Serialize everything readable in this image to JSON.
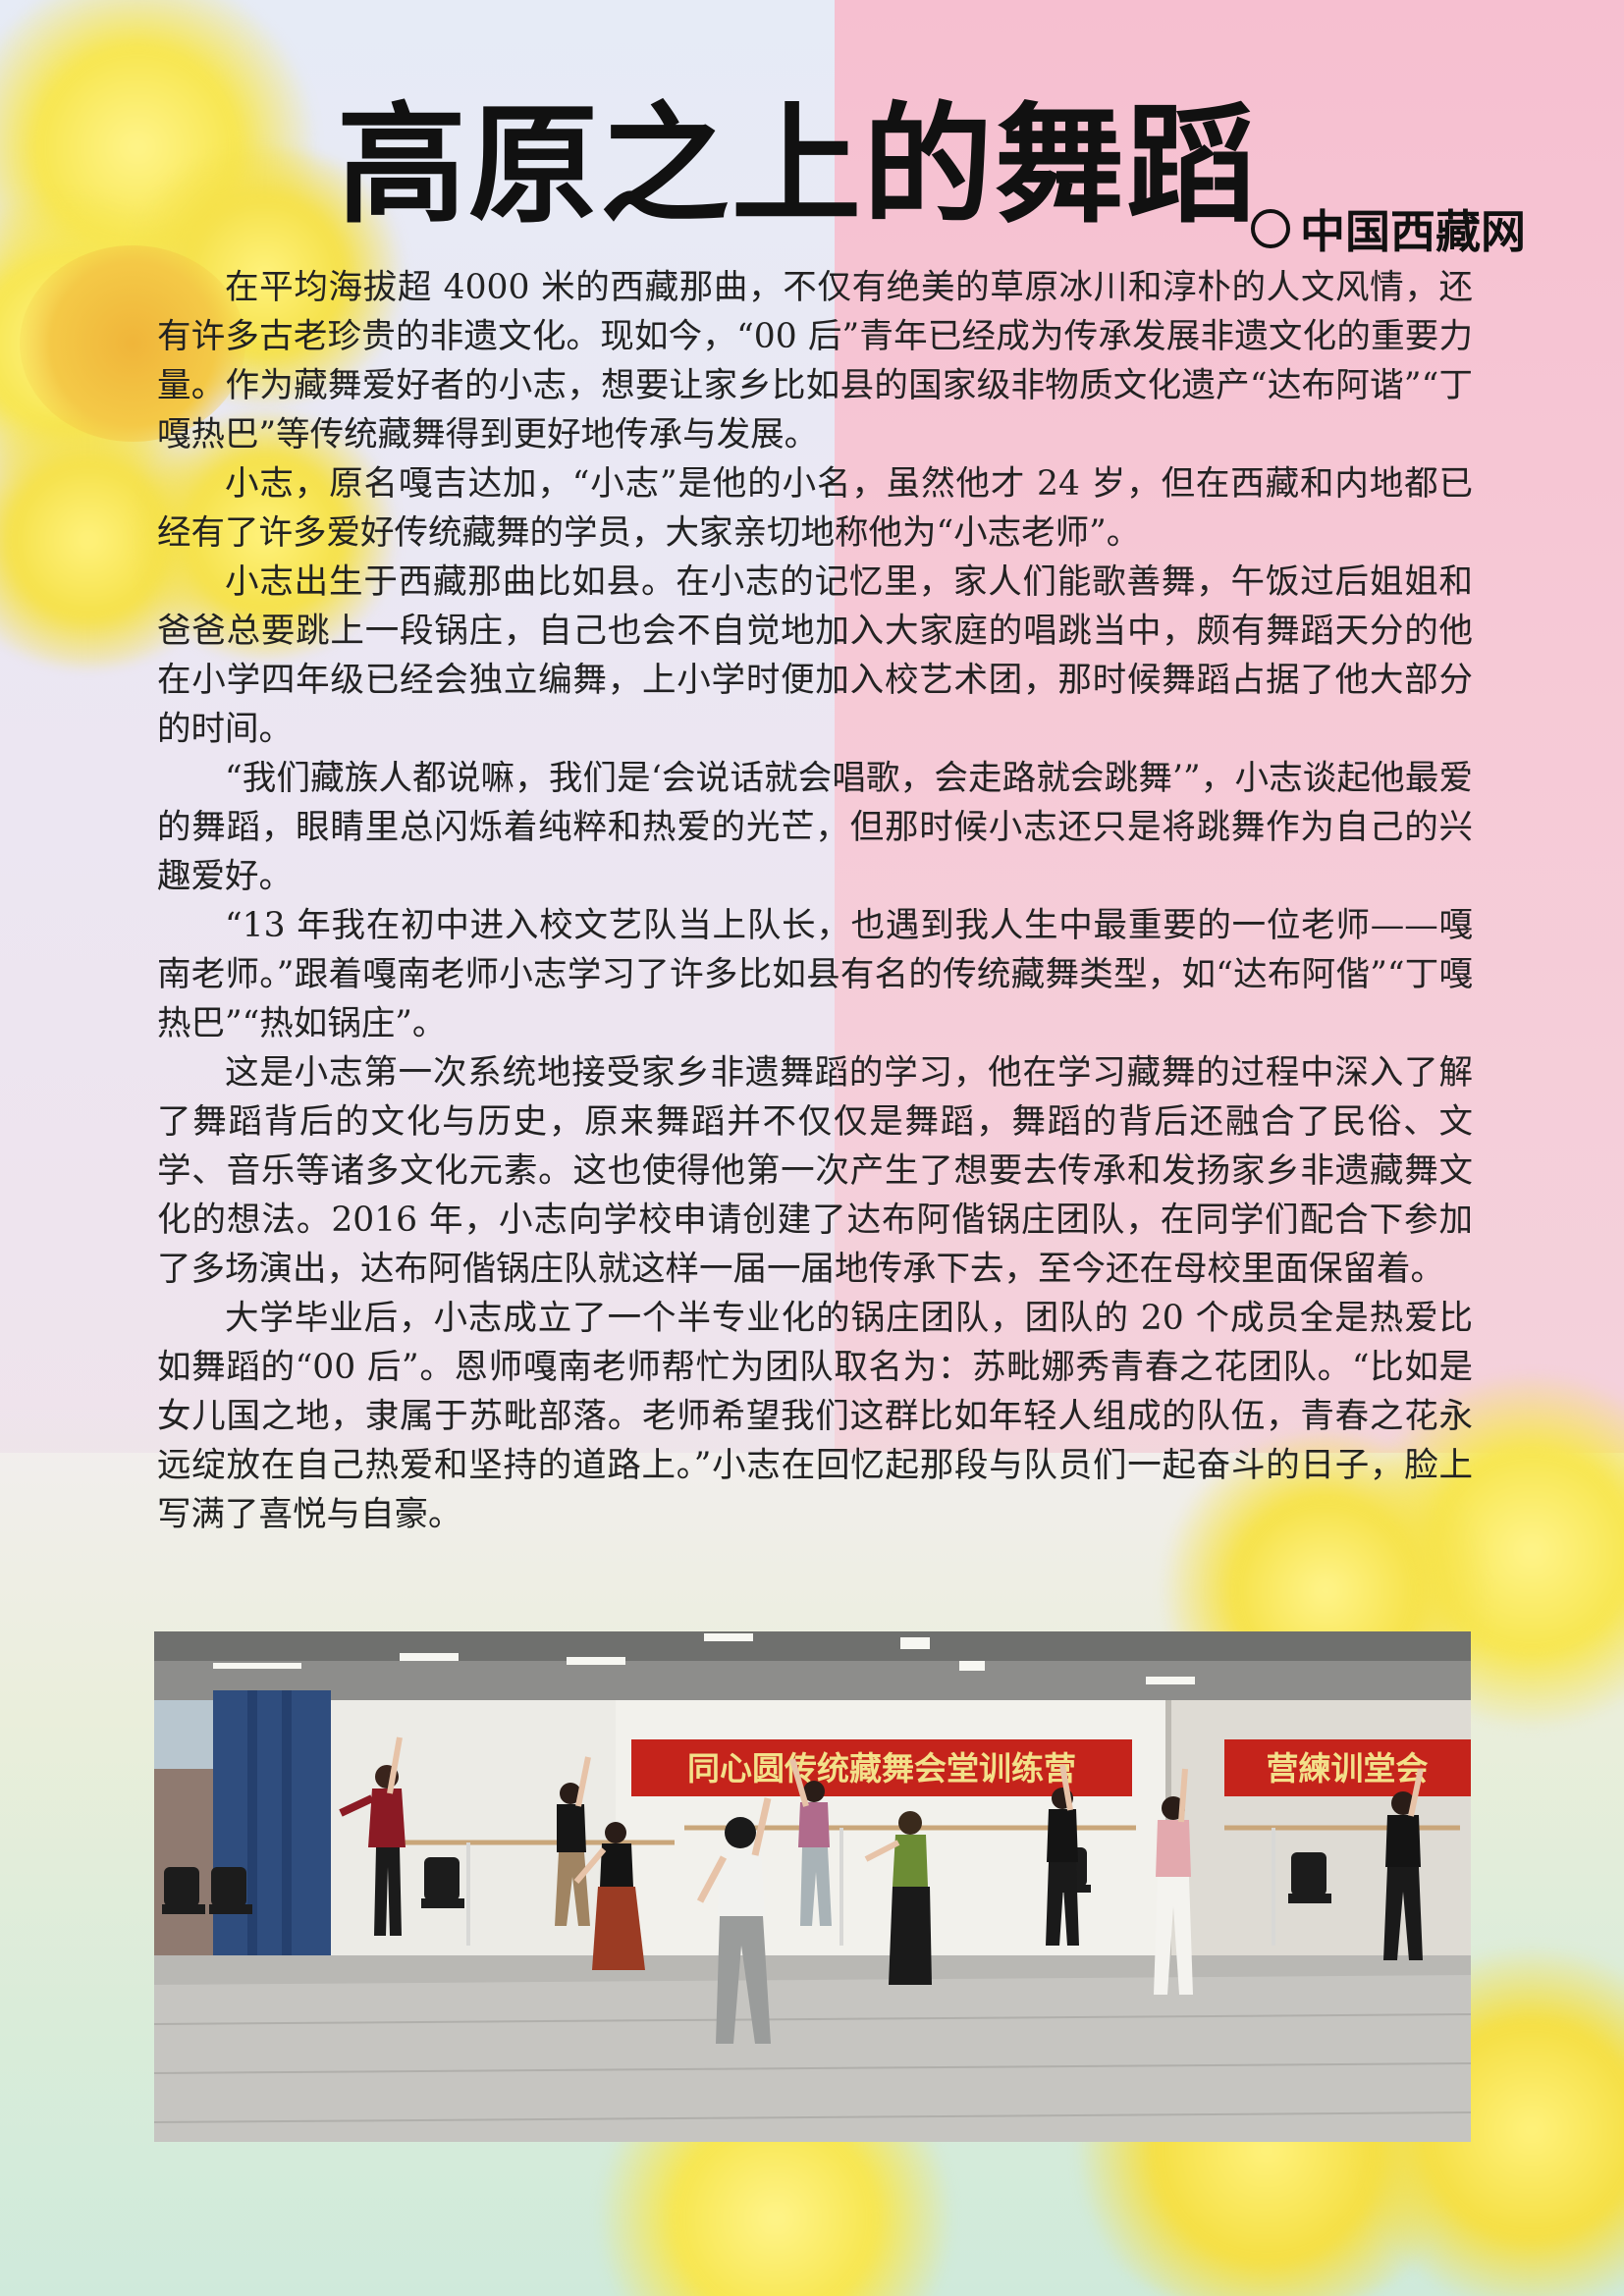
{
  "header": {
    "title": "高原之上的舞蹈",
    "source": "中国西藏网"
  },
  "article": {
    "paragraphs": [
      "在平均海拔超 4000 米的西藏那曲，不仅有绝美的草原冰川和淳朴的人文风情，还有许多古老珍贵的非遗文化。现如今，“00 后”青年已经成为传承发展非遗文化的重要力量。作为藏舞爱好者的小志，想要让家乡比如县的国家级非物质文化遗产“达布阿谐”“丁嘎热巴”等传统藏舞得到更好地传承与发展。",
      "小志，原名嘎吉达加，“小志”是他的小名，虽然他才 24 岁，但在西藏和内地都已经有了许多爱好传统藏舞的学员，大家亲切地称他为“小志老师”。",
      "小志出生于西藏那曲比如县。在小志的记忆里，家人们能歌善舞，午饭过后姐姐和爸爸总要跳上一段锅庄，自己也会不自觉地加入大家庭的唱跳当中，颇有舞蹈天分的他在小学四年级已经会独立编舞，上小学时便加入校艺术团，那时候舞蹈占据了他大部分的时间。",
      "“我们藏族人都说嘛，我们是‘会说话就会唱歌，会走路就会跳舞’”，小志谈起他最爱的舞蹈，眼睛里总闪烁着纯粹和热爱的光芒，但那时候小志还只是将跳舞作为自己的兴趣爱好。",
      "“13 年我在初中进入校文艺队当上队长，也遇到我人生中最重要的一位老师——嘎南老师。”跟着嘎南老师小志学习了许多比如县有名的传统藏舞类型，如“达布阿偕”“丁嘎热巴”“热如锅庄”。",
      "这是小志第一次系统地接受家乡非遗舞蹈的学习，他在学习藏舞的过程中深入了解了舞蹈背后的文化与历史，原来舞蹈并不仅仅是舞蹈，舞蹈的背后还融合了民俗、文学、音乐等诸多文化元素。这也使得他第一次产生了想要去传承和发扬家乡非遗藏舞文化的想法。2016 年，小志向学校申请创建了达布阿偕锅庄团队，在同学们配合下参加了多场演出，达布阿偕锅庄队就这样一届一届地传承下去，至今还在母校里面保留着。",
      "大学毕业后，小志成立了一个半专业化的锅庄团队，团队的 20 个成员全是热爱比如舞蹈的“00 后”。恩师嘎南老师帮忙为团队取名为：苏毗娜秀青春之花团队。“比如是女儿国之地，隶属于苏毗部落。老师希望我们这群比如年轻人组成的队伍，青春之花永远绽放在自己热爱和坚持的道路上。”小志在回忆起那段与队员们一起奋斗的日子，脸上写满了喜悦与自豪。"
    ]
  },
  "photo": {
    "banner_text": "同心圆传统藏舞会堂训练营",
    "mirror_banner_text": "营練训堂会"
  }
}
